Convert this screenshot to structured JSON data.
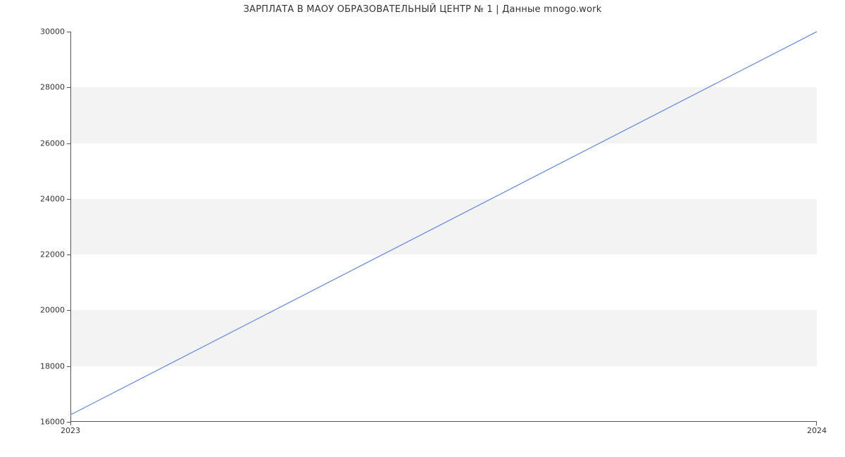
{
  "chart_data": {
    "type": "line",
    "title": "ЗАРПЛАТА В МАОУ ОБРАЗОВАТЕЛЬНЫЙ ЦЕНТР № 1 | Данные mnogo.work",
    "x_categories": [
      "2023",
      "2024"
    ],
    "series": [
      {
        "name": "salary",
        "values": [
          16250,
          30000
        ],
        "color": "#6b8fe3"
      }
    ],
    "xlabel": "",
    "ylabel": "",
    "ylim": [
      16000,
      30000
    ],
    "yticks": [
      16000,
      18000,
      20000,
      22000,
      24000,
      26000,
      28000,
      30000
    ],
    "ytick_labels": [
      "16000",
      "18000",
      "20000",
      "22000",
      "24000",
      "26000",
      "28000",
      "30000"
    ],
    "xtick_labels": [
      "2023",
      "2024"
    ],
    "grid": "horizontal-bands",
    "legend": null
  }
}
